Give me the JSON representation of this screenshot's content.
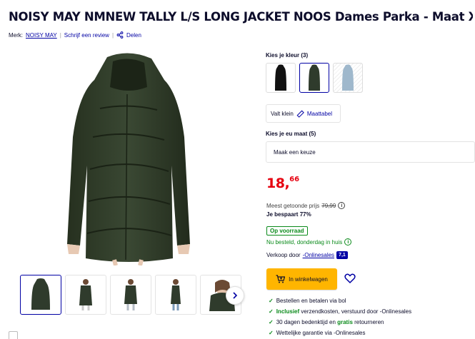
{
  "product": {
    "title": "NOISY MAY NMNEW TALLY L/S LONG JACKET NOOS Dames Parka - Maat XS",
    "brand_label": "Merk:",
    "brand": "NOISY MAY",
    "review_link": "Schrijf een review",
    "share_link": "Delen"
  },
  "colors": {
    "label": "Kies je kleur (3)",
    "options": [
      "black",
      "dark-green",
      "light-blue"
    ],
    "selected": "dark-green"
  },
  "size_guide": {
    "fit_text": "Valt klein",
    "guide_link": "Maattabel"
  },
  "size_select": {
    "label": "Kies je eu maat (5)",
    "value": "Maak een keuze"
  },
  "price": {
    "euros": "18,",
    "cents": "66",
    "reference_label": "Meest getoonde prijs",
    "reference_price": "79,99",
    "savings": "Je bespaart 77%"
  },
  "availability": {
    "badge": "Op voorraad",
    "delivery": "Nu besteld, donderdag in huis"
  },
  "seller": {
    "label": "Verkoop door",
    "name": "-Onlinesales",
    "score": "7,1"
  },
  "cart": {
    "button_label": "In winkelwagen"
  },
  "usps": [
    {
      "pre": "",
      "bold": "",
      "text": "Bestellen en betalen via bol"
    },
    {
      "pre": "",
      "bold": "Inclusief",
      "text": " verzendkosten, verstuurd door -Onlinesales"
    },
    {
      "pre": "30 dagen bedenktijd en ",
      "bold": "gratis",
      "text": " retourneren"
    },
    {
      "pre": "",
      "bold": "",
      "text": "Wettelijke garantie via -Onlinesales"
    }
  ],
  "theme": {
    "brand_blue": "#0000a4",
    "price_red": "#e6000f",
    "stock_green": "#0a8a1a",
    "cart_yellow": "#ffb500",
    "coat_green": "#2f3b2c"
  }
}
